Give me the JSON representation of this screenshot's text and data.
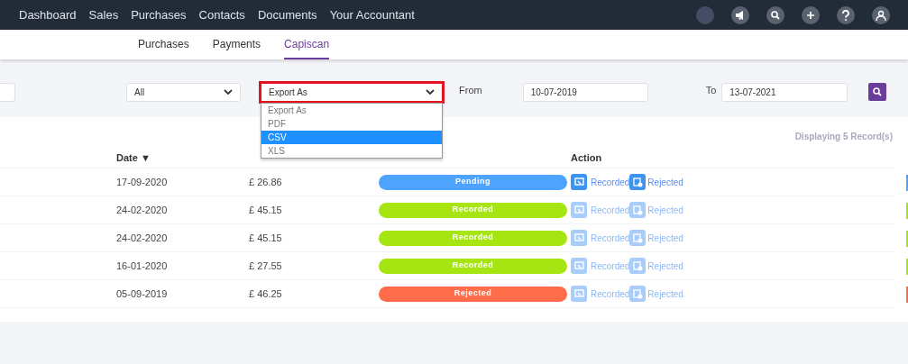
{
  "navbar": {
    "items": [
      {
        "label": "Dashboard"
      },
      {
        "label": "Sales"
      },
      {
        "label": "Purchases"
      },
      {
        "label": "Contacts"
      },
      {
        "label": "Documents"
      },
      {
        "label": "Your Accountant"
      }
    ]
  },
  "subnav": {
    "tabs": [
      {
        "label": "Purchases",
        "selected": false
      },
      {
        "label": "Payments",
        "selected": false
      },
      {
        "label": "Capiscan",
        "selected": true
      }
    ]
  },
  "filters": {
    "status_select": {
      "value": "All"
    },
    "export_select": {
      "value": "Export As",
      "expanded": true,
      "options": [
        {
          "label": "Export As",
          "highlighted": false
        },
        {
          "label": "PDF",
          "highlighted": false
        },
        {
          "label": "CSV",
          "highlighted": true
        },
        {
          "label": "XLS",
          "highlighted": false
        }
      ]
    },
    "from_label": "From",
    "from_date": {
      "value": "10-07-2019"
    },
    "to_label": "To",
    "to_date": {
      "value": "13-07-2021"
    }
  },
  "record_count": "Displaying 5 Record(s)",
  "table": {
    "columns": [
      {
        "label": "Date ▼"
      },
      {
        "label": "Action"
      }
    ],
    "rows": [
      {
        "date": "17-09-2020",
        "amount": "£ 26.86",
        "status": "Pending",
        "color": "#4da3ff",
        "actions_enabled": true,
        "actions": [
          "Recorded",
          "Rejected"
        ]
      },
      {
        "date": "24-02-2020",
        "amount": "£ 45.15",
        "status": "Recorded",
        "color": "#a6e512",
        "actions_enabled": false,
        "actions": [
          "Recorded",
          "Rejected"
        ]
      },
      {
        "date": "24-02-2020",
        "amount": "£ 45.15",
        "status": "Recorded",
        "color": "#a6e512",
        "actions_enabled": false,
        "actions": [
          "Recorded",
          "Rejected"
        ]
      },
      {
        "date": "16-01-2020",
        "amount": "£ 27.55",
        "status": "Recorded",
        "color": "#a6e512",
        "actions_enabled": false,
        "actions": [
          "Recorded",
          "Rejected"
        ]
      },
      {
        "date": "05-09-2019",
        "amount": "£ 46.25",
        "status": "Rejected",
        "color": "#ff6c4a",
        "actions_enabled": false,
        "actions": [
          "Recorded",
          "Rejected"
        ]
      }
    ]
  }
}
